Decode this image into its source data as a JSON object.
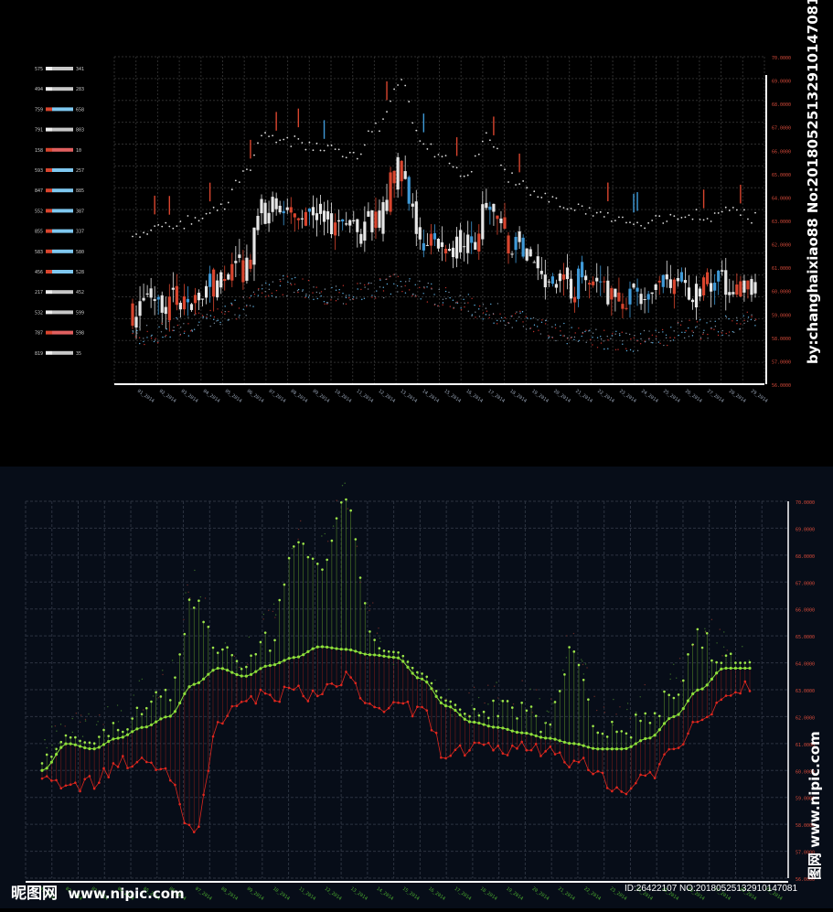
{
  "watermark": {
    "credit": "by:changhaixiao88 No:20180525132910147081",
    "site_vertical": "图网 www.nipic.com",
    "logo": "昵图网",
    "site": "www.nipic.com",
    "id_line": "ID:26422107 NO:20180525132910147081"
  },
  "colors": {
    "top_bg": "#000000",
    "bottom_bg": "#070d18",
    "candle_white": "#e6e6e6",
    "candle_red": "#d9452e",
    "candle_blue": "#3f9ad8",
    "line_green": "#8ee03a",
    "line_red": "#e0271e",
    "axis_red": "#d44a3a",
    "grid": "#333333"
  },
  "chart_data": [
    {
      "type": "candlestick",
      "title": "",
      "xlabel": "",
      "ylabel": "",
      "grid": true,
      "legend": "left",
      "x_range": [
        0,
        28
      ],
      "ylim": [
        56.0,
        70.0
      ],
      "y_ticks": [
        "70.0000",
        "69.0000",
        "68.0000",
        "67.0000",
        "66.0000",
        "65.0000",
        "64.0000",
        "63.0000",
        "62.0000",
        "61.0000",
        "60.0000",
        "59.0000",
        "58.0000",
        "57.0000",
        "56.0000"
      ],
      "close_curve_x": [
        0,
        1,
        2,
        3,
        4,
        5,
        6,
        7,
        8,
        9,
        10,
        11,
        12,
        13,
        14,
        15,
        16,
        17,
        18,
        19,
        20,
        21,
        22,
        23,
        24,
        25,
        26,
        27,
        28
      ],
      "close_curve_y": [
        59.2,
        59.8,
        59.6,
        59.9,
        60.2,
        61.0,
        63.5,
        63.0,
        63.2,
        62.8,
        62.3,
        63.3,
        65.2,
        62.2,
        61.8,
        61.7,
        63.3,
        61.8,
        61.0,
        60.3,
        60.3,
        60.1,
        59.8,
        59.9,
        60.1,
        60.1,
        60.2,
        60.3,
        60.1
      ],
      "upper_dots_y": [
        62.3,
        62.6,
        62.8,
        63.2,
        63.6,
        65.0,
        66.6,
        66.4,
        66.2,
        66.1,
        65.8,
        67.0,
        69.0,
        66.4,
        65.6,
        65.0,
        66.6,
        64.8,
        64.2,
        63.8,
        63.5,
        63.2,
        63.0,
        62.9,
        63.0,
        63.3,
        63.2,
        63.4,
        63.1
      ],
      "lower_dots_y": [
        58.0,
        58.2,
        58.4,
        58.6,
        58.9,
        59.3,
        60.0,
        60.2,
        60.0,
        59.8,
        59.9,
        60.1,
        60.3,
        60.0,
        59.7,
        59.4,
        59.1,
        58.8,
        58.6,
        58.3,
        58.1,
        57.9,
        57.8,
        57.9,
        58.1,
        58.3,
        58.4,
        58.5,
        58.7
      ],
      "candle_count": 170,
      "legend_rows": [
        {
          "left": "575",
          "right": "341",
          "color": "#c8c8c8"
        },
        {
          "left": "494",
          "right": "283",
          "color": "#c8c8c8"
        },
        {
          "left": "759",
          "right": "658",
          "color": "#7fc8f0"
        },
        {
          "left": "791",
          "right": "803",
          "color": "#c8c8c8"
        },
        {
          "left": "158",
          "right": "10",
          "color": "#e06060"
        },
        {
          "left": "593",
          "right": "257",
          "color": "#7fc8f0"
        },
        {
          "left": "847",
          "right": "885",
          "color": "#7fc8f0"
        },
        {
          "left": "552",
          "right": "387",
          "color": "#7fc8f0"
        },
        {
          "left": "855",
          "right": "337",
          "color": "#7fc8f0"
        },
        {
          "left": "583",
          "right": "580",
          "color": "#7fc8f0"
        },
        {
          "left": "456",
          "right": "528",
          "color": "#7fc8f0"
        },
        {
          "left": "217",
          "right": "452",
          "color": "#c8c8c8"
        },
        {
          "left": "532",
          "right": "599",
          "color": "#c8c8c8"
        },
        {
          "left": "787",
          "right": "598",
          "color": "#e06060"
        },
        {
          "left": "819",
          "right": "35",
          "color": "#c8c8c8"
        }
      ],
      "x_tick_labels": [
        "01_2014",
        "02_2014",
        "03_2014",
        "04_2014",
        "05_2014",
        "06_2014",
        "07_2014",
        "08_2014",
        "09_2014",
        "10_2014",
        "11_2014",
        "12_2014",
        "13_2014",
        "14_2014",
        "15_2014",
        "16_2014",
        "17_2014",
        "18_2014",
        "19_2014",
        "20_2014",
        "21_2014",
        "22_2014",
        "23_2014",
        "24_2014",
        "25_2014",
        "26_2014",
        "27_2014",
        "28_2014",
        "29_2014"
      ]
    },
    {
      "type": "line",
      "title": "",
      "xlabel": "",
      "ylabel": "",
      "grid": true,
      "x_range": [
        0,
        28
      ],
      "ylim": [
        56.0,
        70.0
      ],
      "y_ticks": [
        "70.0000",
        "69.0000",
        "68.0000",
        "67.0000",
        "66.0000",
        "65.0000",
        "64.0000",
        "63.0000",
        "62.0000",
        "61.0000",
        "60.0000",
        "59.0000",
        "58.0000",
        "57.0000",
        "56.0000"
      ],
      "series": [
        {
          "color": "#8ee03a",
          "x": [
            0,
            1,
            2,
            3,
            4,
            5,
            6,
            7,
            8,
            9,
            10,
            11,
            12,
            13,
            14,
            15,
            16,
            17,
            18,
            19,
            20,
            21,
            22,
            23,
            24,
            25,
            26,
            27,
            28
          ],
          "y": [
            60.0,
            61.0,
            60.8,
            61.2,
            61.6,
            62.0,
            63.2,
            63.8,
            63.5,
            63.9,
            64.2,
            64.6,
            64.5,
            64.3,
            64.2,
            63.4,
            62.4,
            61.8,
            61.6,
            61.4,
            61.2,
            61.0,
            60.8,
            60.8,
            61.2,
            62.0,
            63.0,
            63.8,
            63.8
          ]
        },
        {
          "color": "#8ee03a",
          "x": [
            0,
            1,
            2,
            3,
            4,
            5,
            6,
            7,
            8,
            9,
            10,
            11,
            12,
            13,
            14,
            15,
            16,
            17,
            18,
            19,
            20,
            21,
            22,
            23,
            24,
            25,
            26,
            27,
            28
          ],
          "y": [
            60.1,
            61.2,
            61.1,
            61.5,
            62.2,
            62.8,
            66.3,
            64.6,
            63.7,
            64.8,
            68.2,
            67.7,
            69.8,
            65.3,
            63.3,
            63.2,
            62.0,
            61.9,
            62.4,
            62.2,
            61.7,
            64.6,
            61.6,
            61.4,
            62.1,
            62.8,
            64.9,
            64.0,
            63.7
          ]
        },
        {
          "color": "#e0271e",
          "x": [
            0,
            1,
            2,
            3,
            4,
            5,
            6,
            7,
            8,
            9,
            10,
            11,
            12,
            13,
            14,
            15,
            16,
            17,
            18,
            19,
            20,
            21,
            22,
            23,
            24,
            25,
            26,
            27,
            28
          ],
          "y": [
            60.1,
            59.4,
            59.6,
            60.2,
            60.6,
            59.8,
            57.6,
            61.6,
            62.6,
            62.8,
            62.9,
            62.8,
            63.5,
            62.4,
            62.3,
            62.2,
            60.6,
            60.8,
            60.7,
            60.9,
            60.8,
            60.4,
            59.8,
            59.2,
            59.9,
            60.7,
            61.9,
            62.8,
            63.2
          ]
        }
      ],
      "stem_count": 150,
      "x_tick_labels": [
        "01_2014",
        "02_2014",
        "03_2014",
        "04_2014",
        "05_2014",
        "06_2014",
        "07_2014",
        "08_2014",
        "09_2014",
        "10_2014",
        "11_2014",
        "12_2014",
        "13_2014",
        "14_2014",
        "15_2014",
        "16_2014",
        "17_2014",
        "18_2014",
        "19_2014",
        "20_2014",
        "21_2014",
        "22_2014",
        "23_2014",
        "24_2014",
        "25_2014",
        "26_2014",
        "27_2014",
        "28_2014",
        "29_2014"
      ]
    }
  ]
}
